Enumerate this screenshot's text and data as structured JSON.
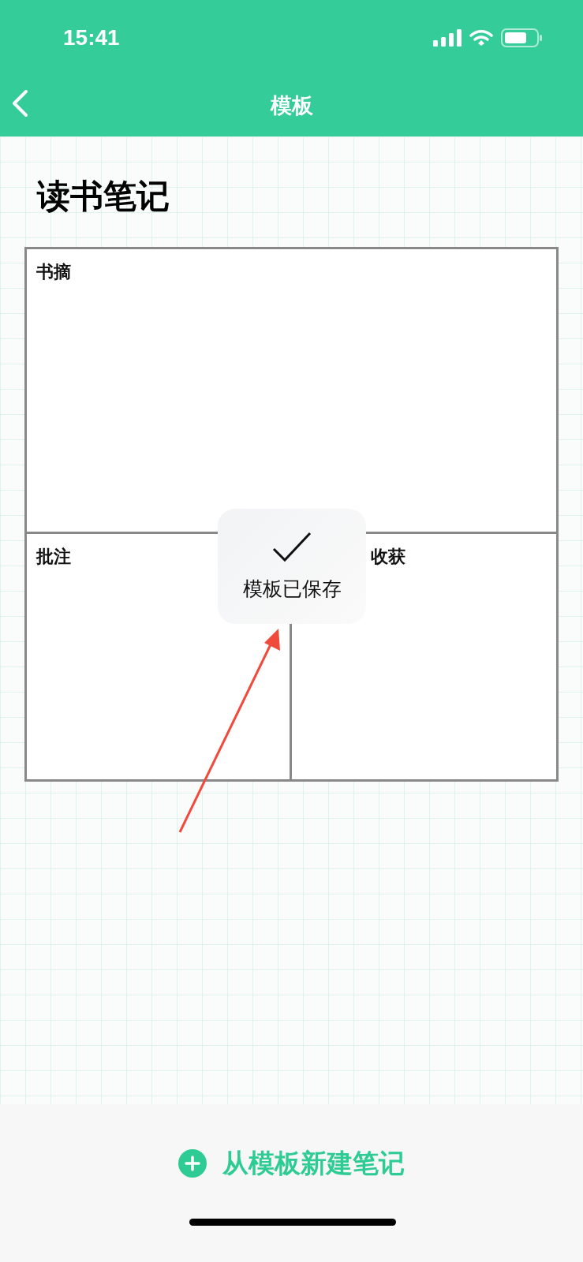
{
  "status_bar": {
    "time": "15:41"
  },
  "nav_bar": {
    "title": "模板"
  },
  "note": {
    "title": "读书笔记",
    "sections": [
      {
        "label": "书摘"
      },
      {
        "label": "批注"
      },
      {
        "label": "收获"
      }
    ]
  },
  "toast": {
    "message": "模板已保存"
  },
  "action_button": {
    "label": "从模板新建笔记"
  }
}
